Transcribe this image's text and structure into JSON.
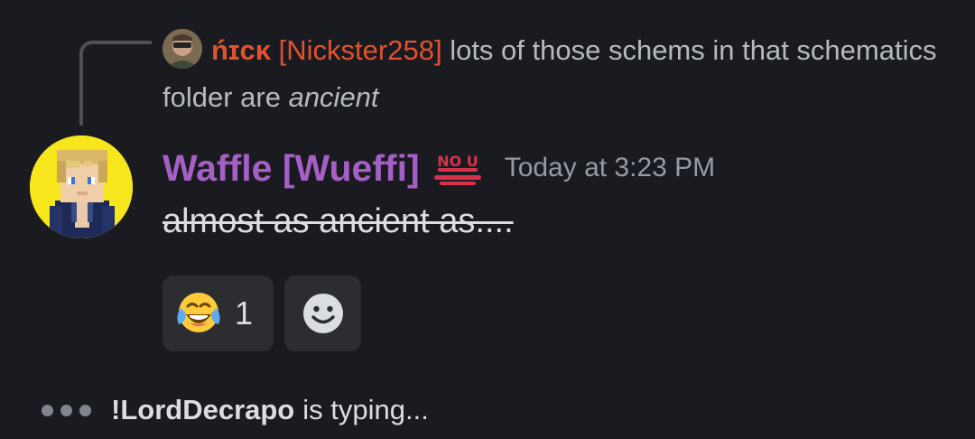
{
  "reply": {
    "author_nick": "ńɪᴄᴋ",
    "author_handle": "[Nickster258]",
    "text_plain": "lots of those schems in that schematics folder are ",
    "text_emphasis": "ancient",
    "author_color": "#e0522f"
  },
  "message": {
    "username": "Waffle [Wueffi]",
    "username_color": "#a65fc5",
    "badge_icon": "no-u-icon",
    "badge_text": "NO U",
    "timestamp": "Today at 3:23 PM",
    "text": "almost as ancient as...."
  },
  "reactions": [
    {
      "emoji": "😂",
      "icon": "face-with-tears-of-joy-icon",
      "count": "1"
    }
  ],
  "add_reaction_icon": "add-reaction-smiley-icon",
  "typing": {
    "name": "!LordDecrapo",
    "suffix": "is typing..."
  },
  "colors": {
    "background": "#1a1b20",
    "reaction_bg": "#2b2d31",
    "muted": "#949ba4"
  }
}
